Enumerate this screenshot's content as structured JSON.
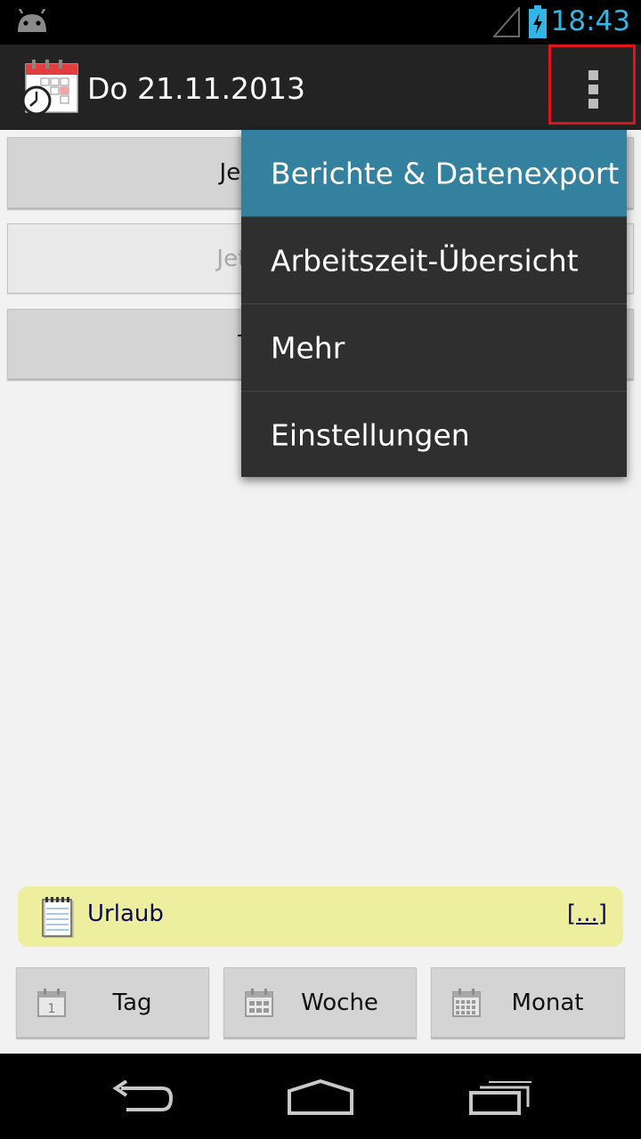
{
  "status_bar": {
    "time": "18:43",
    "icons": [
      "android-icon",
      "signal-icon",
      "battery-charging-icon"
    ],
    "accent": "#33b5e5"
  },
  "action_bar": {
    "title": "Do 21.11.2013",
    "app_icon": "calendar-clock-icon",
    "overflow_icon": "overflow-menu-icon"
  },
  "buttons": {
    "clock_in": "Jetzt einstempeln",
    "clock_out": "Jetzt ausstempeln",
    "switch_task": "Task wechseln"
  },
  "menu": {
    "items": [
      {
        "label": "Berichte & Datenexport",
        "selected": true
      },
      {
        "label": "Arbeitszeit-Übersicht"
      },
      {
        "label": "Mehr"
      },
      {
        "label": "Einstellungen"
      }
    ],
    "selected_color": "#33819e"
  },
  "note": {
    "label": "Urlaub",
    "more": "[...]",
    "icon": "notepad-icon"
  },
  "views": {
    "day": {
      "label": "Tag",
      "icon": "calendar-day-icon",
      "day_number": "1"
    },
    "week": {
      "label": "Woche",
      "icon": "calendar-week-icon"
    },
    "month": {
      "label": "Monat",
      "icon": "calendar-month-icon"
    }
  },
  "nav_bar": {
    "icons": [
      "back-icon",
      "home-icon",
      "recent-apps-icon"
    ]
  }
}
